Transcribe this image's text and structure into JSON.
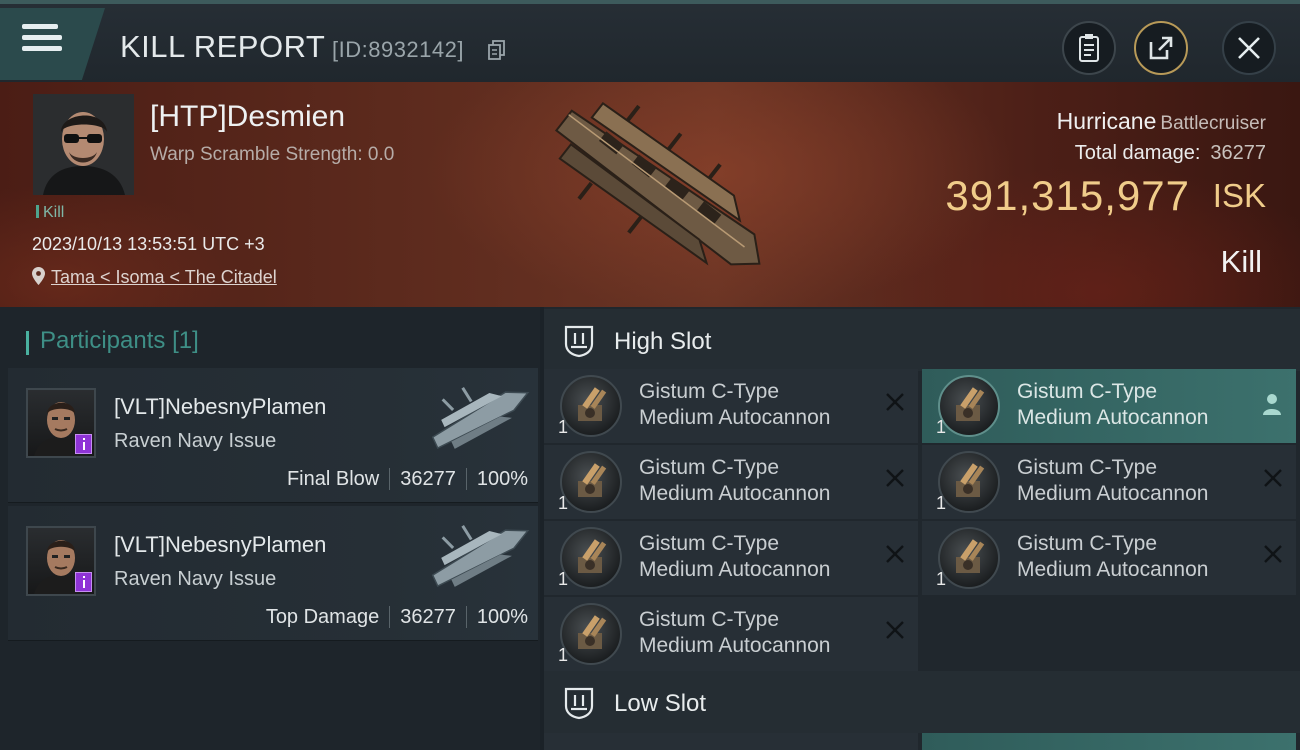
{
  "header": {
    "title": "KILL REPORT",
    "report_id": "[ID:8932142]"
  },
  "victim": {
    "name": "[HTP]Desmien",
    "warp_scramble": "Warp Scramble Strength: 0.0",
    "kill_tag": "Kill",
    "timestamp": "2023/10/13 13:53:51 UTC +3",
    "location": "Tama < Isoma < The Citadel",
    "ship_name": "Hurricane",
    "ship_class": "Battlecruiser",
    "total_damage_label": "Total damage:",
    "total_damage": "36277",
    "isk_value": "391,315,977",
    "isk_unit": "ISK",
    "result": "Kill"
  },
  "participants": {
    "label": "Participants",
    "count": "[1]",
    "items": [
      {
        "name": "[VLT]NebesnyPlamen",
        "ship": "Raven Navy Issue",
        "role": "Final Blow",
        "damage": "36277",
        "percent": "100%"
      },
      {
        "name": "[VLT]NebesnyPlamen",
        "ship": "Raven Navy Issue",
        "role": "Top Damage",
        "damage": "36277",
        "percent": "100%"
      }
    ]
  },
  "high_slot": {
    "label": "High Slot",
    "modules": [
      {
        "line1": "Gistum C-Type",
        "line2": "Medium Autocannon",
        "qty": "1"
      },
      {
        "line1": "Gistum C-Type",
        "line2": "Medium Autocannon",
        "qty": "1"
      },
      {
        "line1": "Gistum C-Type",
        "line2": "Medium Autocannon",
        "qty": "1"
      },
      {
        "line1": "Gistum C-Type",
        "line2": "Medium Autocannon",
        "qty": "1"
      },
      {
        "line1": "Gistum C-Type",
        "line2": "Medium Autocannon",
        "qty": "1"
      },
      {
        "line1": "Gistum C-Type",
        "line2": "Medium Autocannon",
        "qty": "1"
      },
      {
        "line1": "Gistum C-Type",
        "line2": "Medium Autocannon",
        "qty": "1"
      }
    ]
  },
  "low_slot": {
    "label": "Low Slot"
  },
  "colors": {
    "accent_teal": "#4ab1a0",
    "isk_gold": "#f0cc8a",
    "badge_purple": "#8f33d6"
  },
  "icons": [
    "menu-icon",
    "copy-icon",
    "clipboard-icon",
    "share-icon",
    "close-icon",
    "location-pin-icon",
    "slot-icon",
    "remove-icon",
    "pilot-icon"
  ]
}
